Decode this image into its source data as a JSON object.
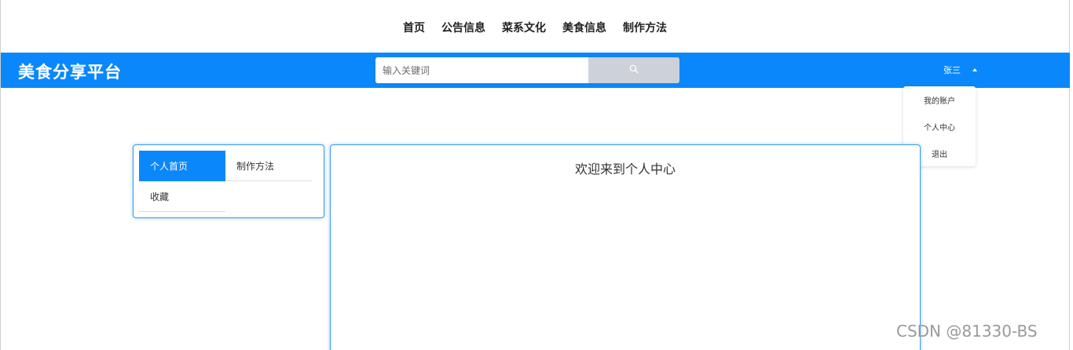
{
  "nav": {
    "items": [
      "首页",
      "公告信息",
      "菜系文化",
      "美食信息",
      "制作方法"
    ]
  },
  "header": {
    "brand": "美食分享平台",
    "search_placeholder": "输入关键词",
    "search_icon": "search-icon",
    "user_name": "张三",
    "accent_color": "#0a88fb"
  },
  "dropdown": {
    "items": [
      "我的账户",
      "个人中心",
      "退出"
    ]
  },
  "side_menu": {
    "items": [
      "个人首页",
      "制作方法",
      "收藏"
    ],
    "active": "个人首页"
  },
  "main": {
    "welcome": "欢迎来到个人中心"
  },
  "watermark": "CSDN @81330-BS"
}
